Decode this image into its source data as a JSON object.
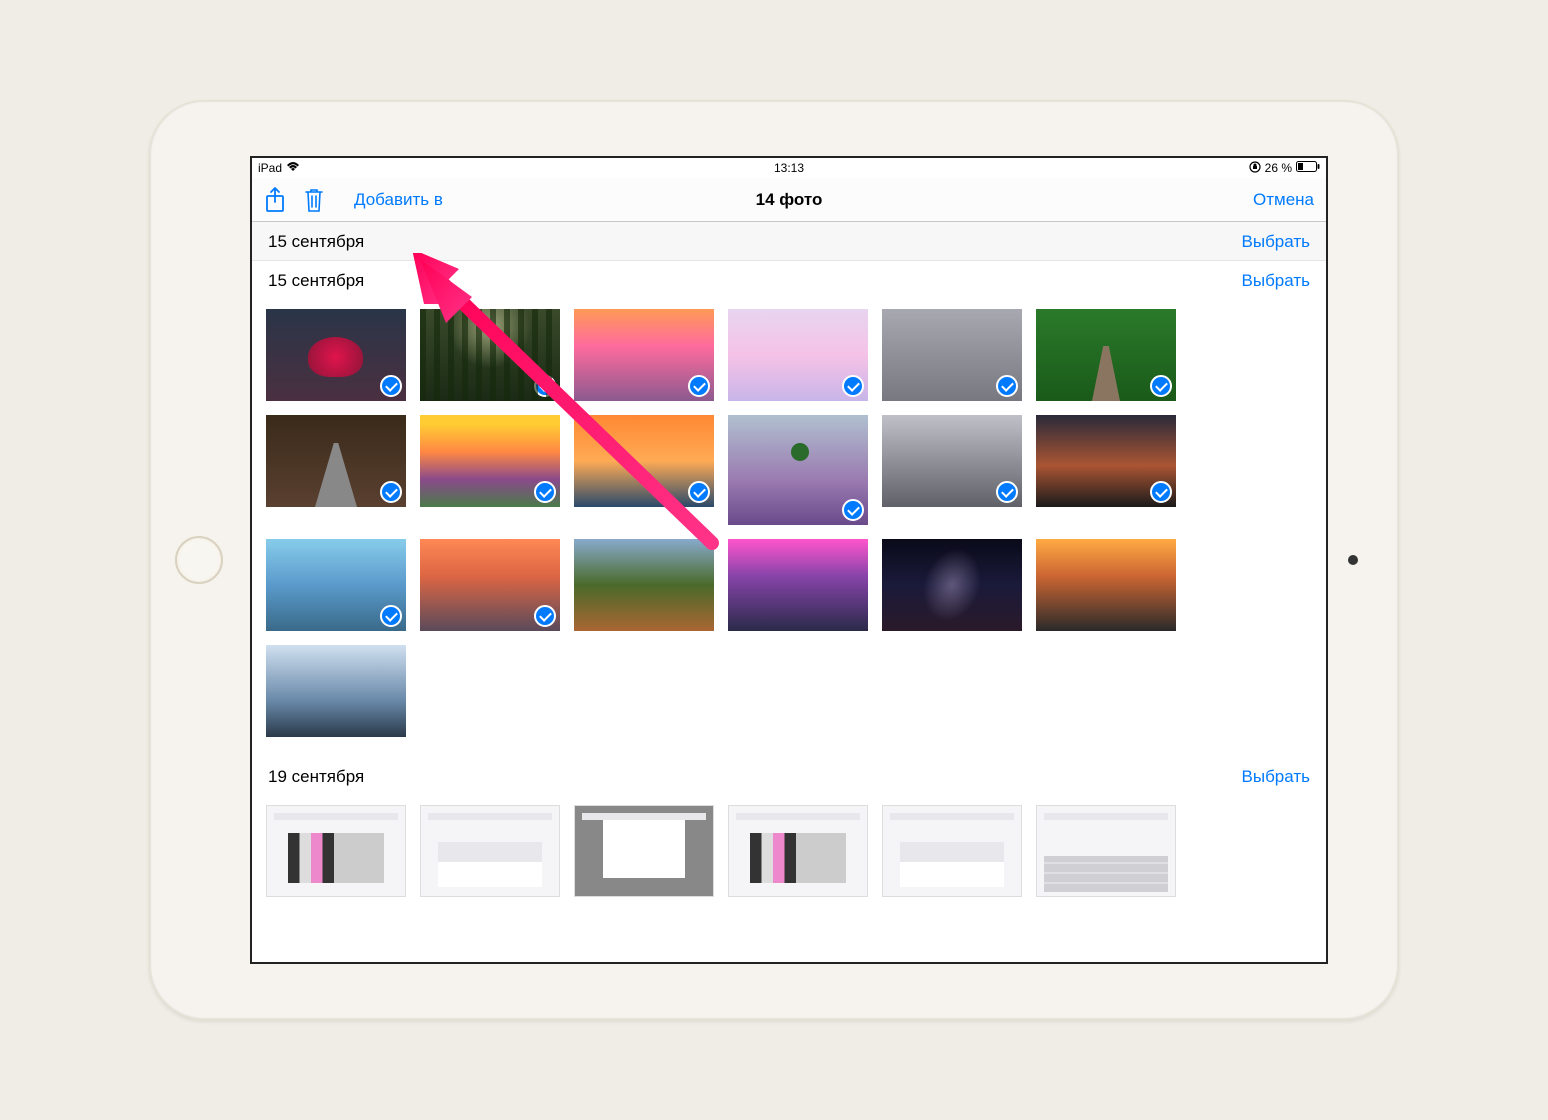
{
  "status": {
    "device": "iPad",
    "time": "13:13",
    "battery": "26 %"
  },
  "nav": {
    "add_to": "Добавить в",
    "title": "14 фото",
    "cancel": "Отмена"
  },
  "sections": [
    {
      "date": "15 сентября",
      "select": "Выбрать",
      "grey": true,
      "photos": []
    },
    {
      "date": "15 сентября",
      "select": "Выбрать",
      "grey": false,
      "photos": [
        {
          "bg": "bg-tree-red",
          "selected": true
        },
        {
          "bg": "bg-forest",
          "selected": true
        },
        {
          "bg": "bg-sunset-bokeh",
          "selected": true
        },
        {
          "bg": "bg-clouds-color",
          "selected": true
        },
        {
          "bg": "bg-city-fog",
          "selected": true
        },
        {
          "bg": "bg-green-path",
          "selected": true
        },
        {
          "bg": "bg-redwood",
          "selected": true
        },
        {
          "bg": "bg-sunrise",
          "selected": true
        },
        {
          "bg": "bg-ocean-sun",
          "selected": true
        },
        {
          "bg": "bg-lavender",
          "selected": true,
          "tall": true
        },
        {
          "bg": "bg-car-grey",
          "selected": true
        },
        {
          "bg": "bg-horizon",
          "selected": true
        },
        {
          "bg": "bg-lake-mtn",
          "selected": true
        },
        {
          "bg": "bg-peaks",
          "selected": true
        },
        {
          "bg": "bg-coral",
          "selected": false
        },
        {
          "bg": "bg-mtn-pink",
          "selected": false
        },
        {
          "bg": "bg-milkyway",
          "selected": false
        },
        {
          "bg": "bg-volcano",
          "selected": false
        },
        {
          "bg": "bg-bay",
          "selected": false
        }
      ]
    },
    {
      "date": "19 сентября",
      "select": "Выбрать",
      "grey": false,
      "photos": [
        {
          "bg": "bg-screenshot",
          "selected": false
        },
        {
          "bg": "bg-screenshot sheet",
          "selected": false
        },
        {
          "bg": "bg-screenshot dialog",
          "selected": false
        },
        {
          "bg": "bg-screenshot",
          "selected": false
        },
        {
          "bg": "bg-screenshot sheet",
          "selected": false
        },
        {
          "bg": "bg-screenshot kbd",
          "selected": false
        }
      ]
    }
  ]
}
